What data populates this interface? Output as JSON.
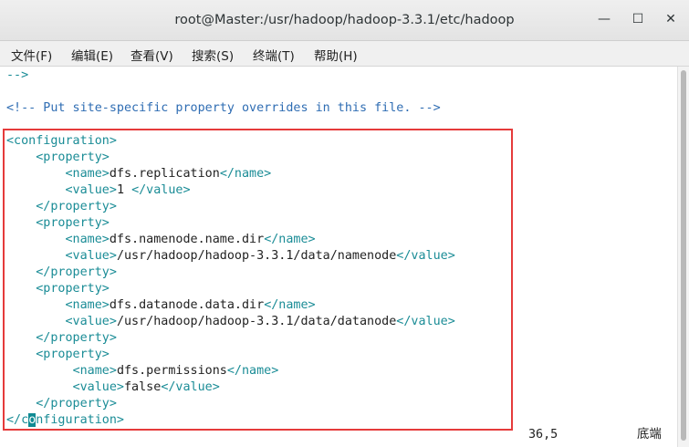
{
  "window": {
    "title": "root@Master:/usr/hadoop/hadoop-3.3.1/etc/hadoop",
    "minimize_glyph": "—",
    "maximize_glyph": "☐",
    "close_glyph": "✕"
  },
  "menu": {
    "file": "文件(F)",
    "edit": "编辑(E)",
    "view": "查看(V)",
    "search": "搜索(S)",
    "terminal": "终端(T)",
    "help": "帮助(H)"
  },
  "editor": {
    "lines": {
      "l1": "-->",
      "l3": "<!-- Put site-specific property overrides in this file. -->",
      "l5": "<configuration>",
      "l6": "<property>",
      "l7_open": "<name>",
      "l7_text": "dfs.replication",
      "l7_close": "</name>",
      "l8_open": "<value>",
      "l8_text": "1",
      "l8_close": "</value>",
      "l9": "</property>",
      "l10": "<property>",
      "l11_open": "<name>",
      "l11_text": "dfs.namenode.name.dir",
      "l11_close": "</name>",
      "l12_open": "<value>",
      "l12_text": "/usr/hadoop/hadoop-3.3.1/data/namenode",
      "l12_close": "</value>",
      "l13": "</property>",
      "l14": "<property>",
      "l15_open": "<name>",
      "l15_text": "dfs.datanode.data.dir",
      "l15_close": "</name>",
      "l16_open": "<value>",
      "l16_text": "/usr/hadoop/hadoop-3.3.1/data/datanode",
      "l16_close": "</value>",
      "l17": "</property>",
      "l18": "<property>",
      "l19_open": "<name>",
      "l19_text": "dfs.permissions",
      "l19_close": "</name>",
      "l20_open": "<value>",
      "l20_text": "false",
      "l20_close": "</value>",
      "l21": "</property>",
      "l22_pre": "</c",
      "l22_cursor": "o",
      "l22_post": "nfiguration>"
    },
    "status_position": "36,5",
    "status_scroll": "底端"
  },
  "colors": {
    "xml_tag": "#1a8c96",
    "comment": "#2f6db3",
    "highlight_border": "#e53b3b",
    "cursor_bg": "#108b94"
  }
}
